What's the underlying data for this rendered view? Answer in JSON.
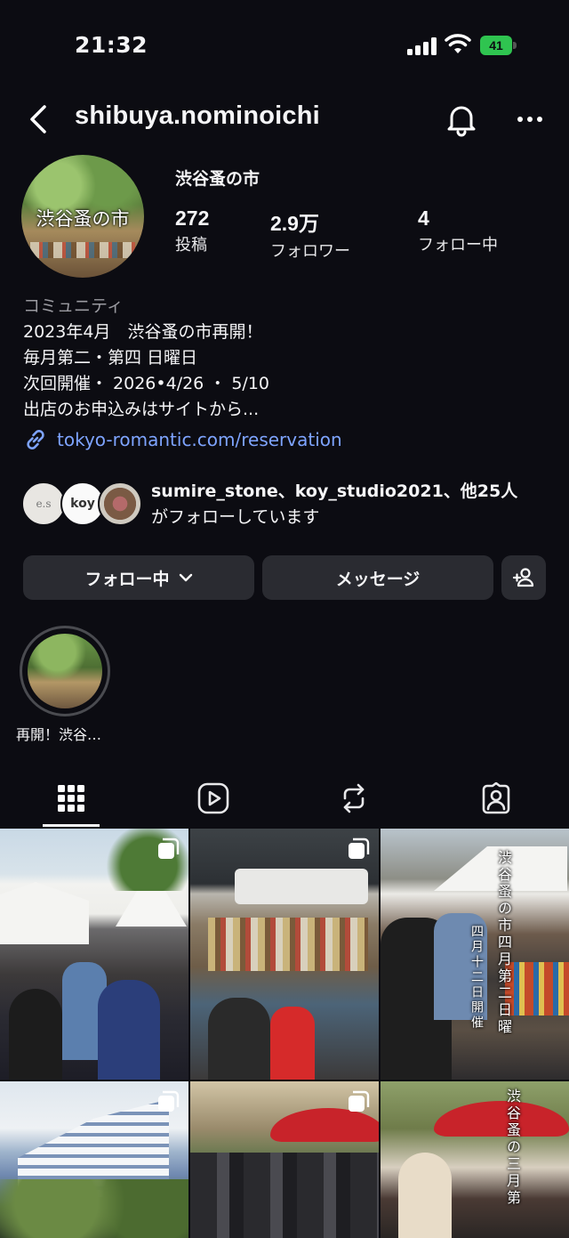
{
  "status_bar": {
    "time": "21:32",
    "battery": "41"
  },
  "header": {
    "username": "shibuya.nominoichi"
  },
  "profile": {
    "display_name": "渋谷蚤の市",
    "avatar_text": "渋谷蚤の市",
    "stats": [
      {
        "value": "272",
        "label": "投稿"
      },
      {
        "value": "2.9万",
        "label": "フォロワー"
      },
      {
        "value": "4",
        "label": "フォロー中"
      }
    ],
    "category": "コミュニティ",
    "bio_lines": [
      "2023年4月　渋谷蚤の市再開！",
      "毎月第二・第四 日曜日",
      "次回開催・ 2026•4/26 ・ 5/10",
      "出店のお申込みはサイトから..."
    ],
    "link": "tokyo-romantic.com/reservation"
  },
  "followed_by": {
    "line1": "sumire_stone、koy_studio2021、他25人",
    "line2": "がフォローしています",
    "avatar_labels": [
      "e.s",
      "koy"
    ]
  },
  "actions": {
    "following_label": "フォロー中",
    "message_label": "メッセージ"
  },
  "highlights": [
    {
      "label": "再開！渋谷…"
    }
  ],
  "tabs": [
    "grid-icon",
    "reels-icon",
    "reposts-icon",
    "tagged-icon"
  ],
  "grid": {
    "overlay_3": "渋谷蚤の市四月第二日曜",
    "overlay_3b": "四月十二日開催",
    "overlay_6": "渋谷蚤の三月第"
  },
  "colors": {
    "link": "#7ea4ff",
    "battery": "#2fc450",
    "button_bg": "#2a2b31"
  }
}
